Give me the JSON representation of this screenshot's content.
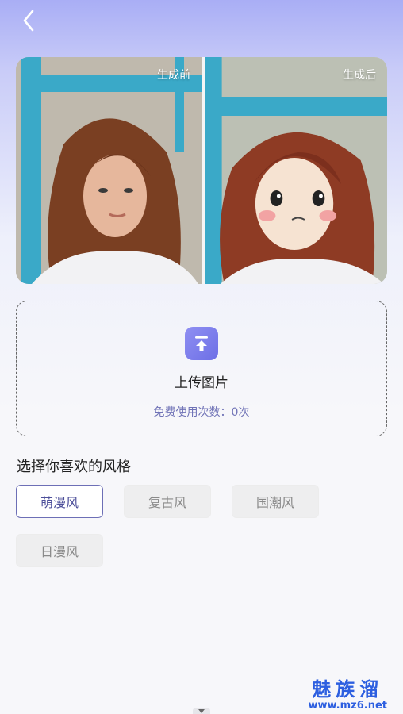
{
  "header": {
    "back_icon": "chevron-left-icon"
  },
  "compare": {
    "before_label": "生成前",
    "after_label": "生成后"
  },
  "upload": {
    "icon": "upload-arrow-icon",
    "title": "上传图片",
    "usage_text": "免费使用次数：0次"
  },
  "styles": {
    "section_title": "选择你喜欢的风格",
    "options": [
      {
        "label": "萌漫风",
        "selected": true
      },
      {
        "label": "复古风",
        "selected": false
      },
      {
        "label": "国潮风",
        "selected": false
      },
      {
        "label": "日漫风",
        "selected": false
      }
    ]
  },
  "watermark": {
    "main": "魅族溜",
    "url": "www.mz6.net"
  },
  "colors": {
    "accent": "#6d6fe6",
    "selected_border": "#6d6fb6",
    "usage_text": "#6f72b6"
  }
}
